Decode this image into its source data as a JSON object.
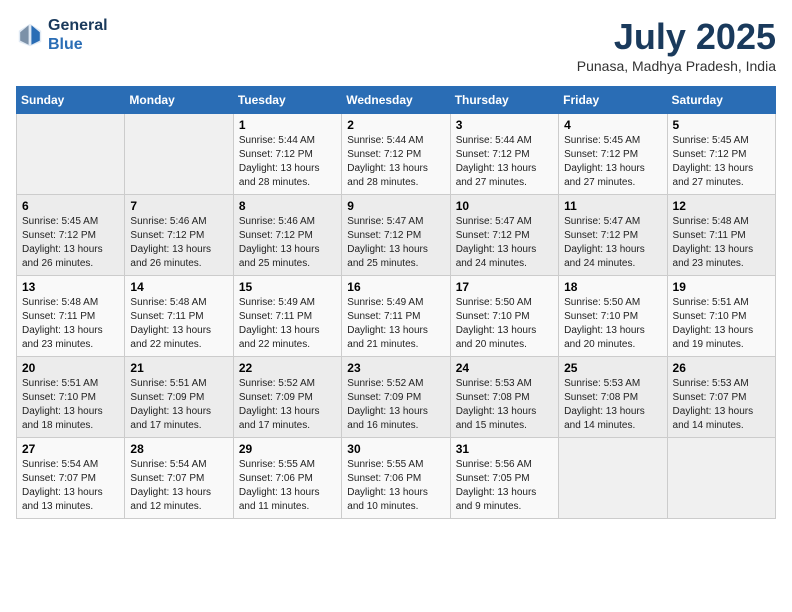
{
  "header": {
    "logo_line1": "General",
    "logo_line2": "Blue",
    "month": "July 2025",
    "location": "Punasa, Madhya Pradesh, India"
  },
  "days_of_week": [
    "Sunday",
    "Monday",
    "Tuesday",
    "Wednesday",
    "Thursday",
    "Friday",
    "Saturday"
  ],
  "weeks": [
    [
      {
        "day": "",
        "info": ""
      },
      {
        "day": "",
        "info": ""
      },
      {
        "day": "1",
        "info": "Sunrise: 5:44 AM\nSunset: 7:12 PM\nDaylight: 13 hours\nand 28 minutes."
      },
      {
        "day": "2",
        "info": "Sunrise: 5:44 AM\nSunset: 7:12 PM\nDaylight: 13 hours\nand 28 minutes."
      },
      {
        "day": "3",
        "info": "Sunrise: 5:44 AM\nSunset: 7:12 PM\nDaylight: 13 hours\nand 27 minutes."
      },
      {
        "day": "4",
        "info": "Sunrise: 5:45 AM\nSunset: 7:12 PM\nDaylight: 13 hours\nand 27 minutes."
      },
      {
        "day": "5",
        "info": "Sunrise: 5:45 AM\nSunset: 7:12 PM\nDaylight: 13 hours\nand 27 minutes."
      }
    ],
    [
      {
        "day": "6",
        "info": "Sunrise: 5:45 AM\nSunset: 7:12 PM\nDaylight: 13 hours\nand 26 minutes."
      },
      {
        "day": "7",
        "info": "Sunrise: 5:46 AM\nSunset: 7:12 PM\nDaylight: 13 hours\nand 26 minutes."
      },
      {
        "day": "8",
        "info": "Sunrise: 5:46 AM\nSunset: 7:12 PM\nDaylight: 13 hours\nand 25 minutes."
      },
      {
        "day": "9",
        "info": "Sunrise: 5:47 AM\nSunset: 7:12 PM\nDaylight: 13 hours\nand 25 minutes."
      },
      {
        "day": "10",
        "info": "Sunrise: 5:47 AM\nSunset: 7:12 PM\nDaylight: 13 hours\nand 24 minutes."
      },
      {
        "day": "11",
        "info": "Sunrise: 5:47 AM\nSunset: 7:12 PM\nDaylight: 13 hours\nand 24 minutes."
      },
      {
        "day": "12",
        "info": "Sunrise: 5:48 AM\nSunset: 7:11 PM\nDaylight: 13 hours\nand 23 minutes."
      }
    ],
    [
      {
        "day": "13",
        "info": "Sunrise: 5:48 AM\nSunset: 7:11 PM\nDaylight: 13 hours\nand 23 minutes."
      },
      {
        "day": "14",
        "info": "Sunrise: 5:48 AM\nSunset: 7:11 PM\nDaylight: 13 hours\nand 22 minutes."
      },
      {
        "day": "15",
        "info": "Sunrise: 5:49 AM\nSunset: 7:11 PM\nDaylight: 13 hours\nand 22 minutes."
      },
      {
        "day": "16",
        "info": "Sunrise: 5:49 AM\nSunset: 7:11 PM\nDaylight: 13 hours\nand 21 minutes."
      },
      {
        "day": "17",
        "info": "Sunrise: 5:50 AM\nSunset: 7:10 PM\nDaylight: 13 hours\nand 20 minutes."
      },
      {
        "day": "18",
        "info": "Sunrise: 5:50 AM\nSunset: 7:10 PM\nDaylight: 13 hours\nand 20 minutes."
      },
      {
        "day": "19",
        "info": "Sunrise: 5:51 AM\nSunset: 7:10 PM\nDaylight: 13 hours\nand 19 minutes."
      }
    ],
    [
      {
        "day": "20",
        "info": "Sunrise: 5:51 AM\nSunset: 7:10 PM\nDaylight: 13 hours\nand 18 minutes."
      },
      {
        "day": "21",
        "info": "Sunrise: 5:51 AM\nSunset: 7:09 PM\nDaylight: 13 hours\nand 17 minutes."
      },
      {
        "day": "22",
        "info": "Sunrise: 5:52 AM\nSunset: 7:09 PM\nDaylight: 13 hours\nand 17 minutes."
      },
      {
        "day": "23",
        "info": "Sunrise: 5:52 AM\nSunset: 7:09 PM\nDaylight: 13 hours\nand 16 minutes."
      },
      {
        "day": "24",
        "info": "Sunrise: 5:53 AM\nSunset: 7:08 PM\nDaylight: 13 hours\nand 15 minutes."
      },
      {
        "day": "25",
        "info": "Sunrise: 5:53 AM\nSunset: 7:08 PM\nDaylight: 13 hours\nand 14 minutes."
      },
      {
        "day": "26",
        "info": "Sunrise: 5:53 AM\nSunset: 7:07 PM\nDaylight: 13 hours\nand 14 minutes."
      }
    ],
    [
      {
        "day": "27",
        "info": "Sunrise: 5:54 AM\nSunset: 7:07 PM\nDaylight: 13 hours\nand 13 minutes."
      },
      {
        "day": "28",
        "info": "Sunrise: 5:54 AM\nSunset: 7:07 PM\nDaylight: 13 hours\nand 12 minutes."
      },
      {
        "day": "29",
        "info": "Sunrise: 5:55 AM\nSunset: 7:06 PM\nDaylight: 13 hours\nand 11 minutes."
      },
      {
        "day": "30",
        "info": "Sunrise: 5:55 AM\nSunset: 7:06 PM\nDaylight: 13 hours\nand 10 minutes."
      },
      {
        "day": "31",
        "info": "Sunrise: 5:56 AM\nSunset: 7:05 PM\nDaylight: 13 hours\nand 9 minutes."
      },
      {
        "day": "",
        "info": ""
      },
      {
        "day": "",
        "info": ""
      }
    ]
  ]
}
